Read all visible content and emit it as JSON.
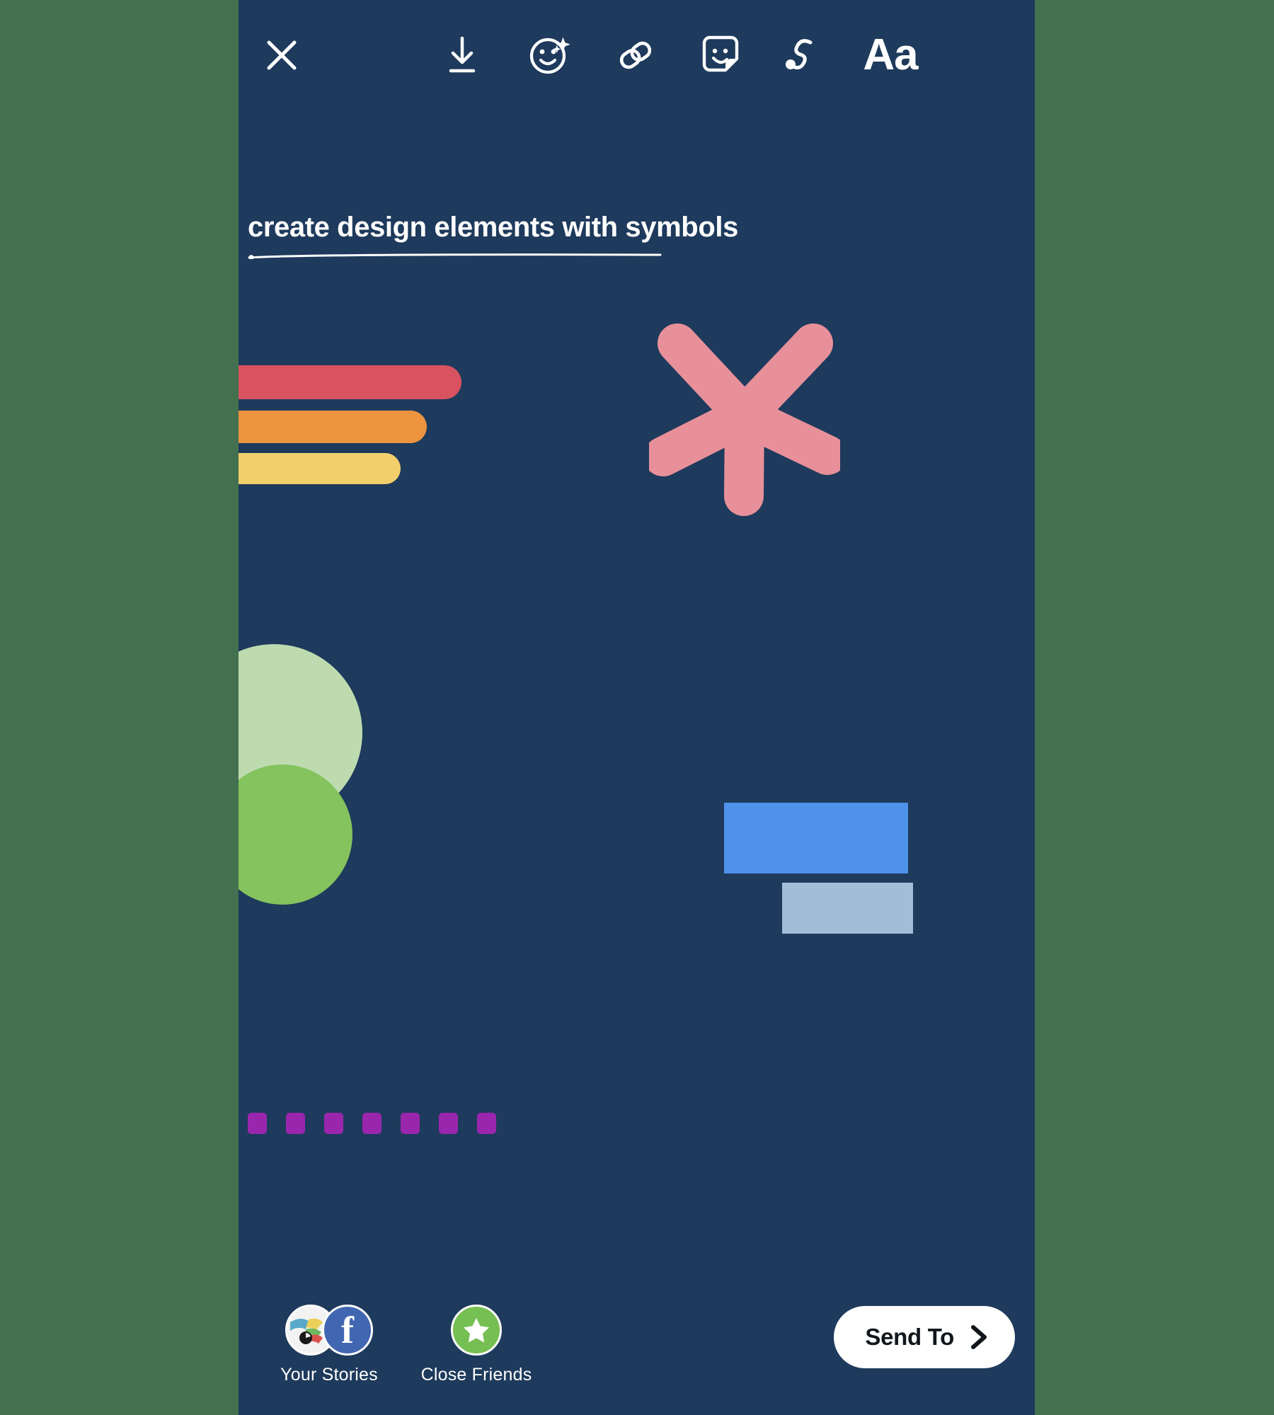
{
  "app": {
    "screen_name": "Instagram Story Editor",
    "canvas_background_color": "#1e3a5c",
    "surround_color": "#43704e"
  },
  "toolbar": {
    "close_label": "close-icon",
    "items": [
      {
        "name": "save-icon",
        "label": "Save to device"
      },
      {
        "name": "effects-icon",
        "label": "Effects"
      },
      {
        "name": "link-icon",
        "label": "Link"
      },
      {
        "name": "sticker-icon",
        "label": "Sticker"
      },
      {
        "name": "draw-icon",
        "label": "Draw"
      },
      {
        "name": "text-icon",
        "label": "Aa"
      }
    ],
    "text_icon_label": "Aa"
  },
  "story": {
    "title": "create design elements with symbols",
    "title_color": "#ffffff",
    "underline_color": "#ffffff"
  },
  "shapes": {
    "bars": [
      {
        "name": "bar-red",
        "color": "#d95260"
      },
      {
        "name": "bar-orange",
        "color": "#ed9440"
      },
      {
        "name": "bar-yellow",
        "color": "#f2cf6b"
      }
    ],
    "asterisk": {
      "name": "asterisk-shape",
      "color": "#e8909a",
      "petals": 5
    },
    "circles": [
      {
        "name": "circle-light-green",
        "color": "#bedbb0"
      },
      {
        "name": "circle-green",
        "color": "#84c35d"
      }
    ],
    "rectangles": [
      {
        "name": "rect-blue",
        "color": "#4e92ec"
      },
      {
        "name": "rect-steel",
        "color": "#a3bcd8"
      }
    ],
    "squares": {
      "name": "purple-square-row",
      "color": "#9a26ae",
      "count": 7
    }
  },
  "bottom": {
    "destinations": [
      {
        "label": "Your Stories",
        "avatar": "profile-avatar",
        "badge": "facebook-icon"
      },
      {
        "label": "Close Friends",
        "avatar": "star-icon",
        "badge": ""
      }
    ],
    "send_to_label": "Send To",
    "send_to_icon": "chevron-right-icon"
  }
}
